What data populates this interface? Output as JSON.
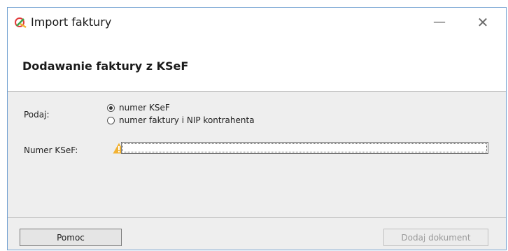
{
  "window": {
    "title": "Import faktury"
  },
  "titlebar": {
    "minimize_glyph": "—",
    "close_glyph": "✕"
  },
  "header": {
    "title": "Dodawanie faktury z KSeF"
  },
  "form": {
    "provide_label": "Podaj:",
    "options": [
      {
        "label": "numer KSeF",
        "selected": true
      },
      {
        "label": "numer faktury i NIP kontrahenta",
        "selected": false
      }
    ],
    "ksef_label": "Numer KSeF:",
    "ksef_value": "",
    "warning_icon": "warning-triangle-icon"
  },
  "footer": {
    "help_label": "Pomoc",
    "add_label": "Dodaj dokument",
    "add_enabled": false
  },
  "colors": {
    "border": "#6f9fd0",
    "warning": "#f2b233",
    "panel": "#eeeeee"
  }
}
